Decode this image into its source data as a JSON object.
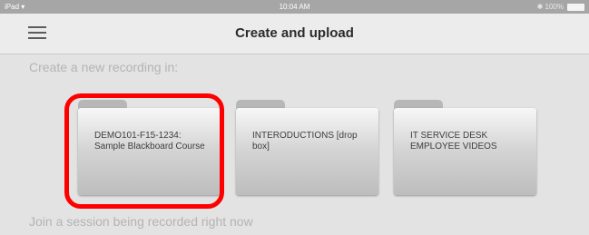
{
  "status_bar": {
    "device": "iPad",
    "time": "10:04 AM",
    "battery": "100%"
  },
  "nav": {
    "title": "Create and upload"
  },
  "create_section": {
    "label": "Create a new recording in:"
  },
  "folders": [
    {
      "label": "DEMO101-F15-1234: Sample Blackboard Course"
    },
    {
      "label": "INTERODUCTIONS [drop box]"
    },
    {
      "label": "IT SERVICE DESK EMPLOYEE VIDEOS"
    }
  ],
  "join_section": {
    "label": "Join a session being recorded right now"
  },
  "colors": {
    "highlight": "#ff0000",
    "background": "#e3e3e3",
    "nav_bar": "#ececec"
  },
  "icons": {
    "menu": "hamburger-menu-icon",
    "wifi": "wifi-icon",
    "bluetooth": "bluetooth-icon",
    "battery": "battery-icon"
  }
}
